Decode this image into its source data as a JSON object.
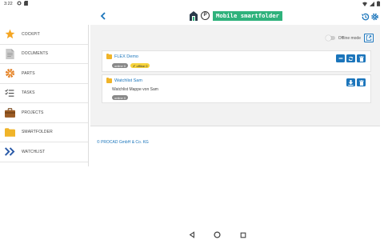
{
  "status_bar": {
    "time": "3:22"
  },
  "app_bar": {
    "title": "Mobile smartfolder",
    "badge_letter": "P"
  },
  "sidebar": {
    "items": [
      {
        "label": "COCKPIT",
        "icon": "star-icon"
      },
      {
        "label": "DOCUMENTS",
        "icon": "document-icon"
      },
      {
        "label": "PARTS",
        "icon": "gear-part-icon"
      },
      {
        "label": "TASKS",
        "icon": "tasks-icon"
      },
      {
        "label": "PROJECTS",
        "icon": "briefcase-icon"
      },
      {
        "label": "SMARTFOLDER",
        "icon": "folder-icon"
      },
      {
        "label": "WATCHLIST",
        "icon": "chevrons-icon"
      }
    ]
  },
  "main": {
    "offline_label": "Offline mode",
    "offline_enabled": false,
    "cards": [
      {
        "title": "FLEX Demo",
        "tags": [
          "online 0",
          "offline 0"
        ],
        "description": ""
      },
      {
        "title": "Watchlist Sam",
        "tags": [
          "online 0"
        ],
        "description": "Watchlist Mappe von Sam"
      }
    ],
    "copyright": "© PROCAD GmbH & Co. KG"
  },
  "colors": {
    "accent": "#1b75bb",
    "title_bg": "#2fb27c",
    "folder": "#f0b429",
    "tag_offline": "#f6d33c"
  }
}
